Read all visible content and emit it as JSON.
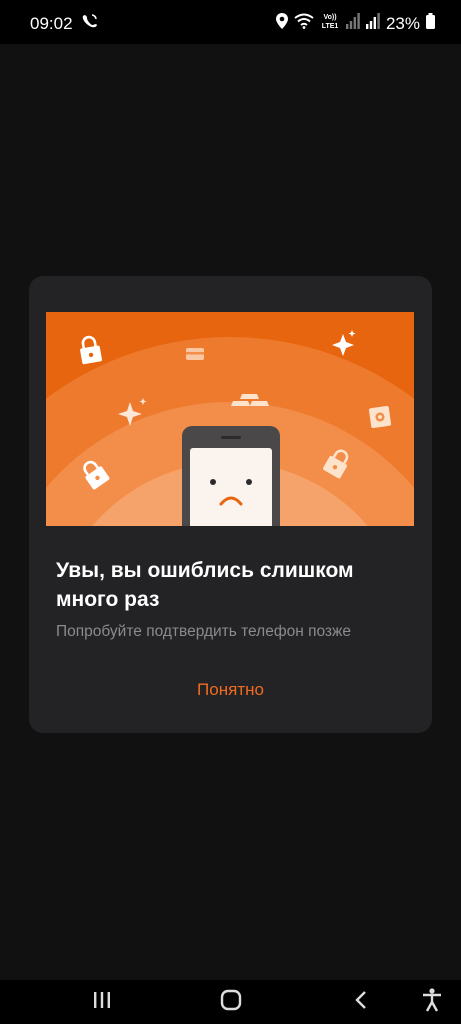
{
  "status_bar": {
    "time": "09:02",
    "network_label": "VoLTE1",
    "battery": "23%"
  },
  "dialog": {
    "title": "Увы, вы ошиблись слишком много раз",
    "subtitle": "Попробуйте подтвердить телефон позже",
    "button_label": "Понятно"
  },
  "colors": {
    "accent": "#F06A1E",
    "illustration_bg": "#E8650F",
    "dialog_bg": "#232326"
  },
  "icons": {
    "status_left": [
      "viber-icon"
    ],
    "status_right": [
      "location-icon",
      "wifi-icon",
      "volte-icon",
      "signal-icon",
      "signal-icon-2",
      "battery-icon"
    ],
    "illustration": [
      "lock-icon",
      "card-icon",
      "sparkle-icon",
      "gold-bars-icon",
      "safe-icon",
      "phone-sad-face"
    ],
    "nav": [
      "recent-apps-icon",
      "home-icon",
      "back-icon",
      "accessibility-icon"
    ]
  }
}
